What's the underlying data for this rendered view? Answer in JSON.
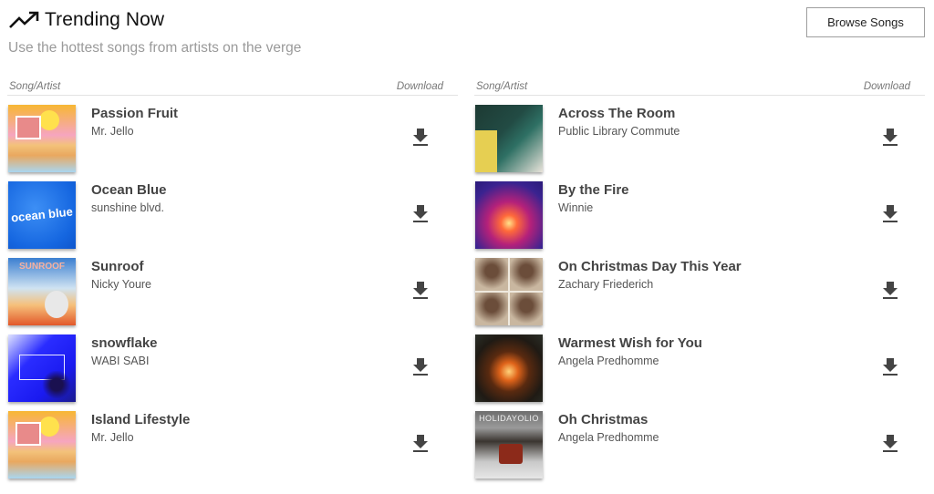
{
  "header": {
    "icon": "trending-up-icon",
    "title": "Trending Now",
    "subtitle": "Use the hottest songs from artists on the verge",
    "browse_button": "Browse Songs"
  },
  "columns_header": {
    "song_artist": "Song/Artist",
    "download": "Download"
  },
  "left_songs": [
    {
      "title": "Passion Fruit",
      "artist": "Mr. Jello",
      "art": "island-album-art"
    },
    {
      "title": "Ocean Blue",
      "artist": "sunshine blvd.",
      "art": "ocean-blue-album-art",
      "art_text": "ocean blue"
    },
    {
      "title": "Sunroof",
      "artist": "Nicky Youre",
      "art": "sunroof-album-art",
      "art_text": "SUNROOF"
    },
    {
      "title": "snowflake",
      "artist": "WABI SABI",
      "art": "snowflake-album-art"
    },
    {
      "title": "Island Lifestyle",
      "artist": "Mr. Jello",
      "art": "island-album-art"
    }
  ],
  "right_songs": [
    {
      "title": "Across The Room",
      "artist": "Public Library Commute",
      "art": "across-the-room-album-art"
    },
    {
      "title": "By the Fire",
      "artist": "Winnie",
      "art": "by-the-fire-album-art"
    },
    {
      "title": "On Christmas Day This Year",
      "artist": "Zachary Friederich",
      "art": "christmas-day-album-art"
    },
    {
      "title": "Warmest Wish for You",
      "artist": "Angela Predhomme",
      "art": "warmest-wish-album-art"
    },
    {
      "title": "Oh Christmas",
      "artist": "Angela Predhomme",
      "art": "oh-christmas-album-art",
      "art_text": "HOLIDAYOLIO"
    }
  ],
  "download_icon": "download-icon"
}
